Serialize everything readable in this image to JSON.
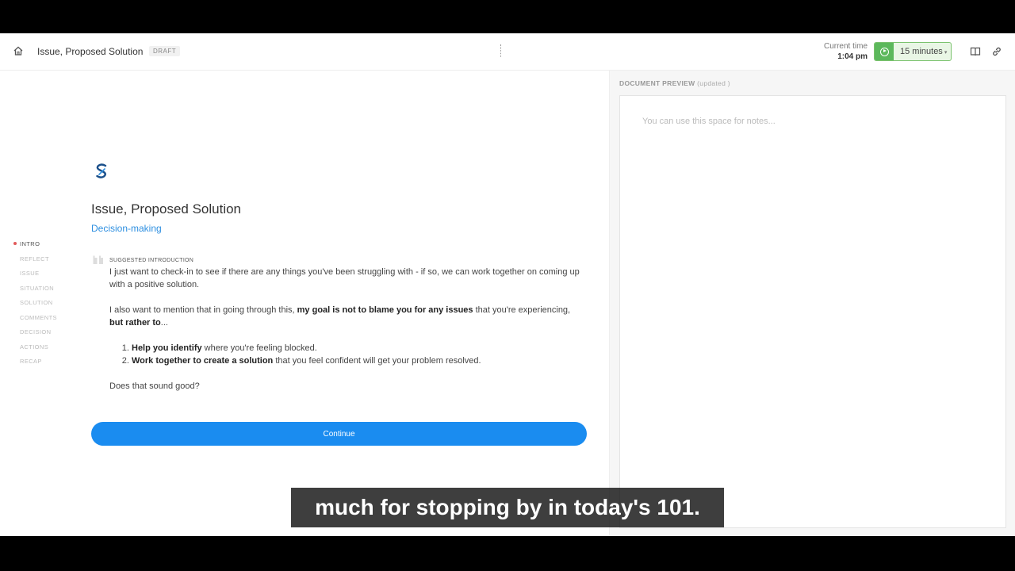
{
  "header": {
    "title": "Issue, Proposed Solution",
    "badge": "DRAFT",
    "time_label": "Current time",
    "time_value": "1:04 pm",
    "timer_value": "15 minutes"
  },
  "steps": [
    "INTRO",
    "REFLECT",
    "ISSUE",
    "SITUATION",
    "SOLUTION",
    "COMMENTS",
    "DECISION",
    "ACTIONS",
    "RECAP"
  ],
  "main": {
    "title": "Issue, Proposed Solution",
    "category": "Decision-making",
    "section_label": "SUGGESTED INTRODUCTION",
    "p1": "I just want to check-in to see if there are any things you've been struggling with - if so, we can work together on coming up with a positive solution.",
    "p2_a": "I also want to mention that in going through this, ",
    "p2_b": "my goal is not to blame you for any issues",
    "p2_c": " that you're experiencing, ",
    "p2_d": "but rather to",
    "p2_e": "...",
    "li1_b": "Help you identify",
    "li1_t": " where you're feeling blocked.",
    "li2_b": "Work together to create a solution",
    "li2_t": " that you feel confident will get your problem resolved.",
    "p3": "Does that sound good?",
    "continue_label": "Continue"
  },
  "preview": {
    "label": "DOCUMENT PREVIEW",
    "updated": "(updated )",
    "notes_placeholder": "You can use this space for notes..."
  },
  "caption": "much for stopping by in today's 101.",
  "colors": {
    "accent_blue": "#1a8cf0",
    "timer_green": "#5cb85c",
    "active_dot": "#e25a5a"
  }
}
